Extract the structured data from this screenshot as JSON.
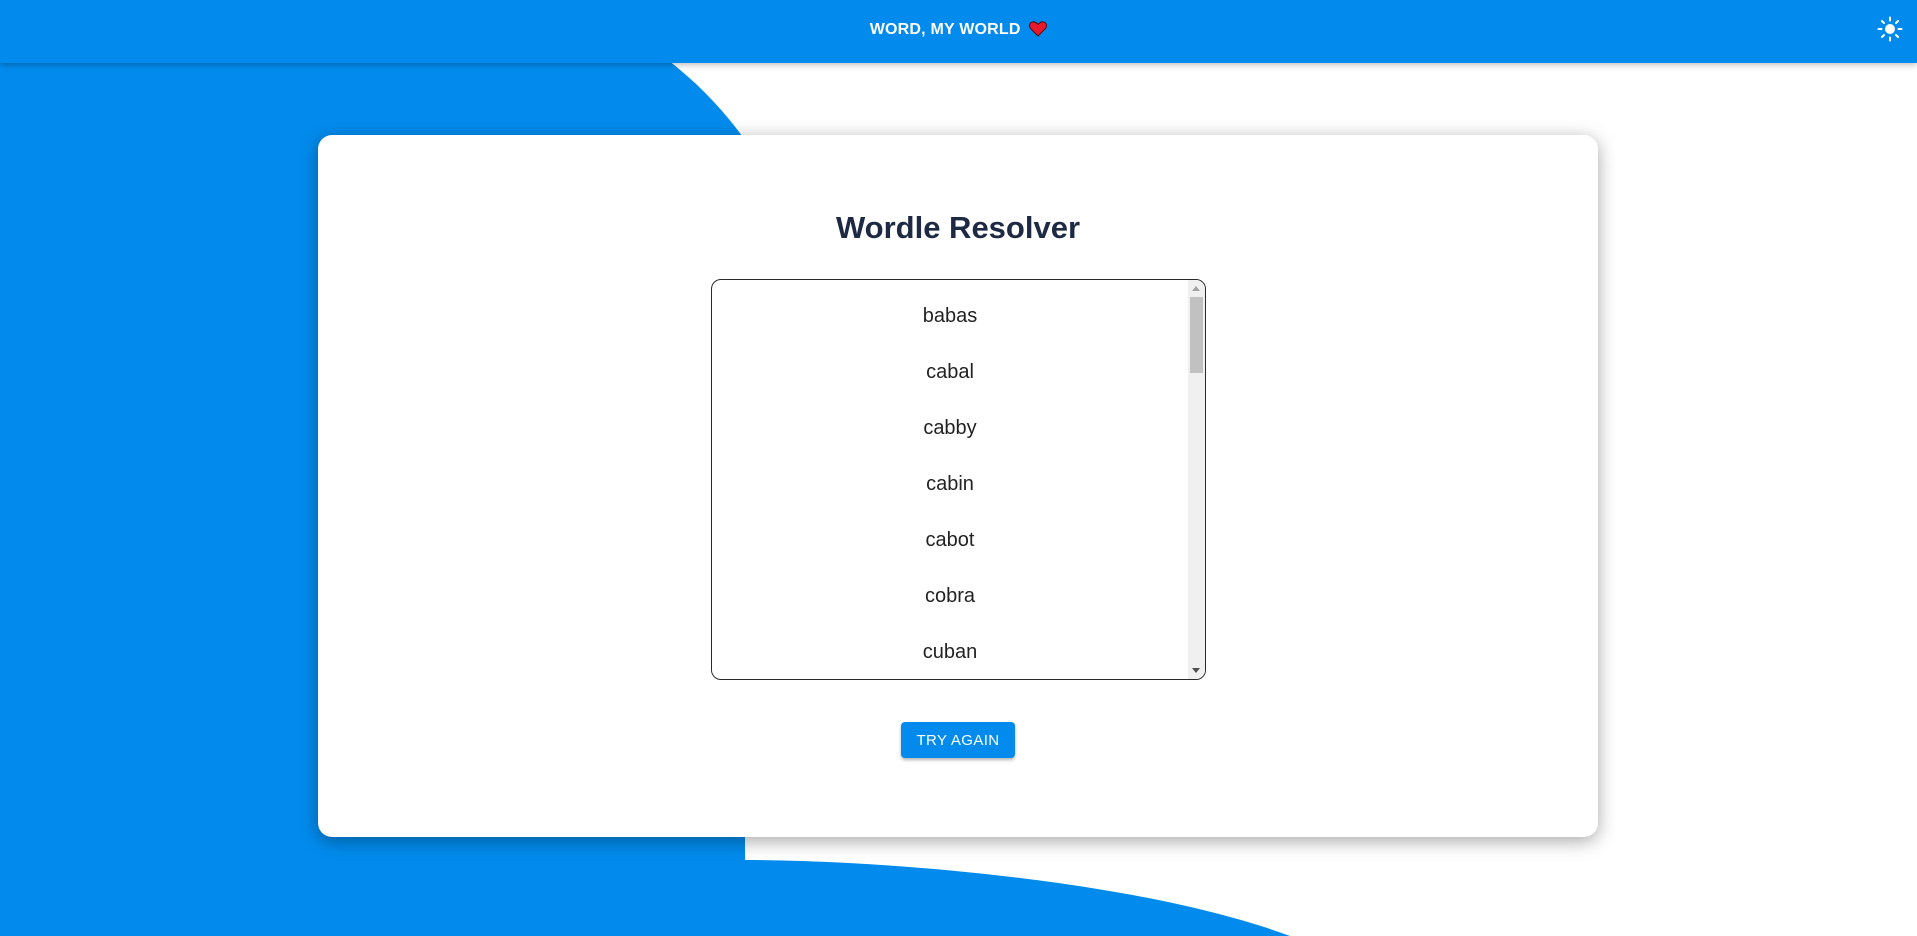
{
  "header": {
    "title": "WORD, MY WORLD",
    "heart_icon": "heart-icon",
    "theme_toggle_icon": "sun-icon"
  },
  "card": {
    "title": "Wordle Resolver",
    "words": [
      "babas",
      "cabal",
      "cabby",
      "cabin",
      "cabot",
      "cobra",
      "cuban"
    ],
    "try_again_label": "TRY AGAIN"
  },
  "colors": {
    "brand_blue": "#028bed",
    "title_text": "#1e2a44",
    "heart_red": "#e8192c"
  }
}
